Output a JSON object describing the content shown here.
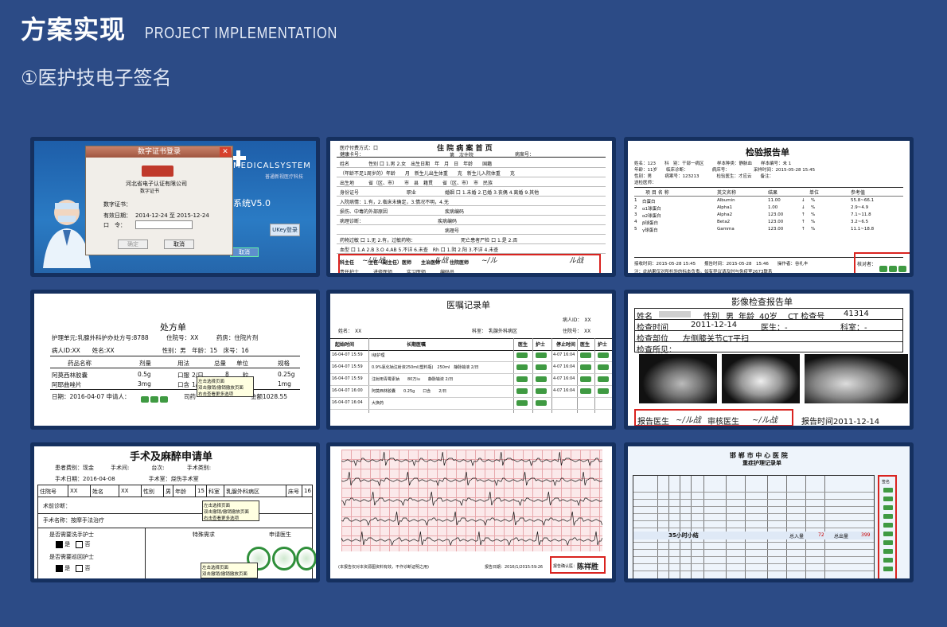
{
  "header": {
    "title_cn": "方案实现",
    "title_en": "PROJECT IMPLEMENTATION",
    "subtitle": "①医护技电子签名"
  },
  "colors": {
    "background": "#2c4b86",
    "card_border": "#15305f",
    "highlight": "#d9231f",
    "stamp": "#3f9a42"
  },
  "cards": {
    "login": {
      "dialog_title": "数字证书登录",
      "company": "河北省电子认证有限公司",
      "company_sub": "数字证书",
      "cert_label": "数字证书：",
      "valid_label": "有效日期：",
      "valid_value": "2014-12-24 至 2015-12-24",
      "pwd_label": "口　令：",
      "ok": "确定",
      "cancel": "取消",
      "brand": "MEDICALSYSTEM",
      "brand_sub": "普通新视医疗科技",
      "system": "系统V5.0",
      "ukey": "UKey登录",
      "cancel2": "取消"
    },
    "inpatient": {
      "title": "住 院 病 案 首 页",
      "line1": "医疗付费方式：口",
      "line2": "健康卡号：",
      "line3": "第　次住院",
      "line4": "病案号：",
      "rows": [
        "姓名　　　　性别 口 1.男 2.女　出生日期　年　月　日　年龄　　国籍",
        "（年龄不足1周岁的）年龄　　月　新生儿出生体重　　克　新生儿入院体重　　克",
        "出生地　　　省（区、市）　　市　县　籍贯　　省（区、市）　市　民族",
        "身份证号　　　　　　　　　　职业　　　　　　婚姻 口 1.未婚 2.已婚 3.丧偶 4.离婚 9.其他",
        "入院病情：1.有，2.临床未确定，3.情况不明，4.无",
        "损伤、中毒的外部原因　　　　　　　　　　　　疾病编码",
        "病理诊断：　　　　　　　　　　　　　　　　疾病编码",
        "　　　　　　　　　　　　　　　　　　　　　　病理号",
        "药物过敏 口 1.无 2.有，过敏药物：　　　　　　　　　　死亡患者尸检 口 1.是 2.否",
        "血型 口 1.A 2.B 3.O 4.AB 5.不详 6.未查　Rh 口 1.阴 2.阳 3.不详 4.未查"
      ],
      "sign": "科主任　　　主任（副主任）医师　　主治医师　　住院医师",
      "sign2": "责任护士　　　进修医师　　　实习医师　　　编码员"
    },
    "lab": {
      "title": "检验报告单",
      "meta1": "姓名：123　　科　别：干部一病区　　　样本种类：静脉血　　样本编号：未 1",
      "meta2": "年龄：11岁　　临床诊断：　　　　　　病床号：　　　　　　采样时间：2015-05-28 15:45",
      "meta3": "性别：男　　　病案号：123213　　　　检验医生：才应云　　备注：",
      "meta4": "送检医师：",
      "headers": [
        "项 目 名 称",
        "英文名称",
        "结果",
        "单位",
        "参考值"
      ],
      "rows": [
        [
          "1",
          "白蛋白",
          "Albumin",
          "11.00",
          "↓",
          "%",
          "55.8~66.1"
        ],
        [
          "2",
          "α1球蛋白",
          "Alpha1",
          "1.00",
          "↓",
          "%",
          "2.9~4.9"
        ],
        [
          "3",
          "α2球蛋白",
          "Alpha2",
          "123.00",
          "↑",
          "%",
          "7.1~11.8"
        ],
        [
          "4",
          "β球蛋白",
          "Beta2",
          "123.00",
          "↑",
          "%",
          "3.2~6.5"
        ],
        [
          "5",
          "γ球蛋白",
          "Gamma",
          "123.00",
          "↑",
          "%",
          "11.1~18.8"
        ]
      ],
      "foot1": "接收时间：2015-05-28 15:45　　报告时间：2015-05-28　15:46　　操作者：谷礼丰",
      "foot2": "注：此结果仅对所检验的标本负责。如有异议请及时与免疫室2673联系",
      "checker": "核对者："
    },
    "rx": {
      "title": "处方单",
      "line1": "护理单元:乳腺外科护办处方号:8788　　　住院号：XX　　　药房：住院片剂",
      "line2": "病人ID:XX　　姓名:XX　　　　　　　　性别：男　年龄：15　床号：16",
      "headers": [
        "药品名称",
        "剂量",
        "用法",
        "总量",
        "单位",
        "规格"
      ],
      "row1": [
        "阿莫西林胶囊",
        "0.5g",
        "口服",
        "2/日",
        "8",
        "粒",
        "0.25g"
      ],
      "row2": [
        "阿耶曲唑片",
        "3mg",
        "口含",
        "1/日",
        "",
        "",
        "1mg"
      ],
      "date": "日期：2016-04-07 申请人：",
      "pharm": "司药",
      "total": "金额1028.55",
      "tooltip1": "左击选择页面",
      "tooltip2": "双击撤销/撤销撤放页面",
      "tooltip3": "右击查看更多选项"
    },
    "orders": {
      "title": "医嘱记录单",
      "patient_id": "病人ID：　XX",
      "name": "姓名：　XX",
      "dept": "科室：　乳腺外科病区",
      "admit": "住院号：　XX",
      "headers": [
        "起始时间",
        "长期医嘱",
        "医生",
        "护士",
        "停止时间",
        "医生",
        "护士"
      ],
      "rows": [
        [
          "16-04-07 15:59",
          "Ⅰ级护理",
          "",
          "",
          "4-07 16:04"
        ],
        [
          "16-04-07 15:59",
          "0.9%氯化钠注射液250ml(塑料瓶)　250ml　静脉输液 2/日",
          "",
          "",
          "4-07 16:04"
        ],
        [
          "16-04-07 15:59",
          "注射用青霉素钠　　80万iu　　静脉输液 2/日",
          "",
          "",
          "4-07 16:04"
        ],
        [
          "16-04-07 16:00",
          "阿莫西林胶囊　　0.25g　　口含　　2/日",
          "",
          "",
          "4-07 16:04"
        ],
        [
          "16-04-07 16:04",
          "大换药",
          "",
          "",
          ""
        ]
      ]
    },
    "imaging": {
      "title": "影像检查报告单",
      "r1": [
        "姓名",
        "性别",
        "男",
        "年龄",
        "40岁",
        "CT 检查号",
        "41314"
      ],
      "r2": [
        "检查时间",
        "2011-12-14",
        "医生：-",
        "科室：-"
      ],
      "r3": [
        "检查部位",
        "左侧膝关节CT平扫"
      ],
      "r4": "检查所见：",
      "foot_doc": "报告医生",
      "foot_check": "审核医生",
      "foot_time": "报告时间2011-12-14"
    },
    "surgery": {
      "title": "手术及麻醉申请单",
      "r1": "患者费别：现金　　　手术间:　　　　台次:　　　　手术类别:",
      "r2": "手术日期：2016-04-08　　　　　　手术室：烧伤手术室",
      "headers": [
        "住院号",
        "XX",
        "姓名",
        "XX",
        "性别",
        "男",
        "年龄",
        "15",
        "科室",
        "乳腺外科病区",
        "床号",
        "16"
      ],
      "diag": "术前诊断：",
      "op": "手术名称：按摩手法治疗",
      "nurse1": "是否需要洗手护士",
      "special": "特殊需求",
      "applicant": "申请医生",
      "nurse2": "是否需要巡回护士",
      "yes": "是",
      "no": "否",
      "tooltip1": "左击选择页面",
      "tooltip2": "双击撤销/撤销撤放页面",
      "tooltip3": "右击查看更多选项"
    },
    "ecg": {
      "foot_left": "(本报告仅对本资源图资料有效，不作诊断证明之用)",
      "foot_mid": "报告日期：2016/1/2015:59:26",
      "signer": "报告确认医：",
      "signature": "陈祥胜"
    },
    "icu": {
      "hospital": "邯 郸 市 中 心 医 院",
      "title": "重症护理记录单",
      "summary": "35小时小结",
      "input": "总入量",
      "input_val": "72",
      "output": "总出量",
      "output_val": "399",
      "sign_col": "签名"
    }
  }
}
